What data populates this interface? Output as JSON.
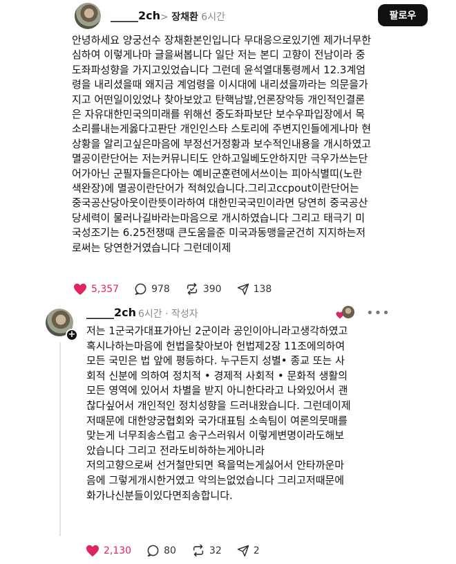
{
  "post": {
    "username": "_____2ch",
    "separator": ">",
    "tagged_name": "장채환",
    "time": "6시간",
    "follow_label": "팔로우",
    "body_lines": [
      "안녕하세요 양궁선수 장채환본인입니다 무대응으로있기엔 제가너무한",
      "심하여 이렇게나마 글을써봅니다 일단 저는 본디 고향이 전남이라 중",
      "도좌파성향을 가지고있었습니다 그런데 윤석열대통령께서 12.3계엄",
      "령을 내리셨을때 왜지금 계엄령을 이시대에 내리셨을까라는 의문을가",
      "지고 어떤일이있었나 찾아보았고 탄핵남발,언론장악등 개인적인결론",
      "은 자유대한민국의미래를 위해선 중도좌파보단 보수우파입장에서 목",
      "소리를내는게옳다고판단 개인인스타 스토리에 주변지인들에게나마 현",
      "상황을 알리고싶은마음에 부정선거정황과 보수적인내용을 개시하였고",
      "멸공이란단어는 저는커뮤니티도 안하고일베도안하지만 극우가쓰는단",
      "어가아닌 군필자들은다아는 예비군훈련에서쓰이는 피아식별띠(노란",
      "색완장)에 멸공이란단어가 적혀있습니다.그리고ccpout이란단어는",
      "중국공산당아웃이란뜻이라하여 대한민국국민이라면 당연히 중국공산",
      "당세력이 물러나길바라는마음으로 개시하였습니다 그리고 태극기 미",
      "국성조기는 6.25전쟁때 큰도움을준 미국과동맹을굳건히 지지하는저",
      "로써는 당연한거였습니다 그런데이제"
    ],
    "likes": "5,357",
    "comments": "978",
    "reposts": "390",
    "shares": "138"
  },
  "reply": {
    "username": "_____2ch",
    "time": "6시간",
    "author_tag": "· 작성자",
    "body_lines": [
      "저는 1군국가대표가아닌 2군이라 공인이아니라고생각하였고",
      "혹시나하는마음에 헌법을찾아보아 헌법제2장 11조에의하여",
      "모든 국민은 법 앞에 평등하다. 누구든지 성별• 종교 또는 사",
      "회적 신분에 의하여 정치적 • 경제적 사회적 • 문화적 생활의",
      "모든 영역에 있어서 차별을 받지 아니한다라고 나와있어서 괜",
      "찮다싶어서 개인적인 정치성향을 드러내왔습니다. 그런데이제",
      "저때문에 대한양궁협회와 국가대표팀 소속팀이 여론의뭇매를",
      "맞는게 너무죄송스럽고 송구스러워서 이렇게변명이라도해보",
      "았습니다 그리고 전라도비하하는게아니라",
      "저의고향으로써 선거철만되면 욕을먹는게싫어서 안타까운마",
      "음에 그렇게개시한거였고 악의는없었습니다 그리고저때문에",
      "화가나신분들이있다면죄송합니다."
    ],
    "likes": "2,130",
    "comments": "80",
    "reposts": "32",
    "shares": "2",
    "more_label": "•••"
  },
  "colors": {
    "like_red": "#e0245e",
    "button_bg": "#111111",
    "meta_gray": "#8a8a8a"
  }
}
